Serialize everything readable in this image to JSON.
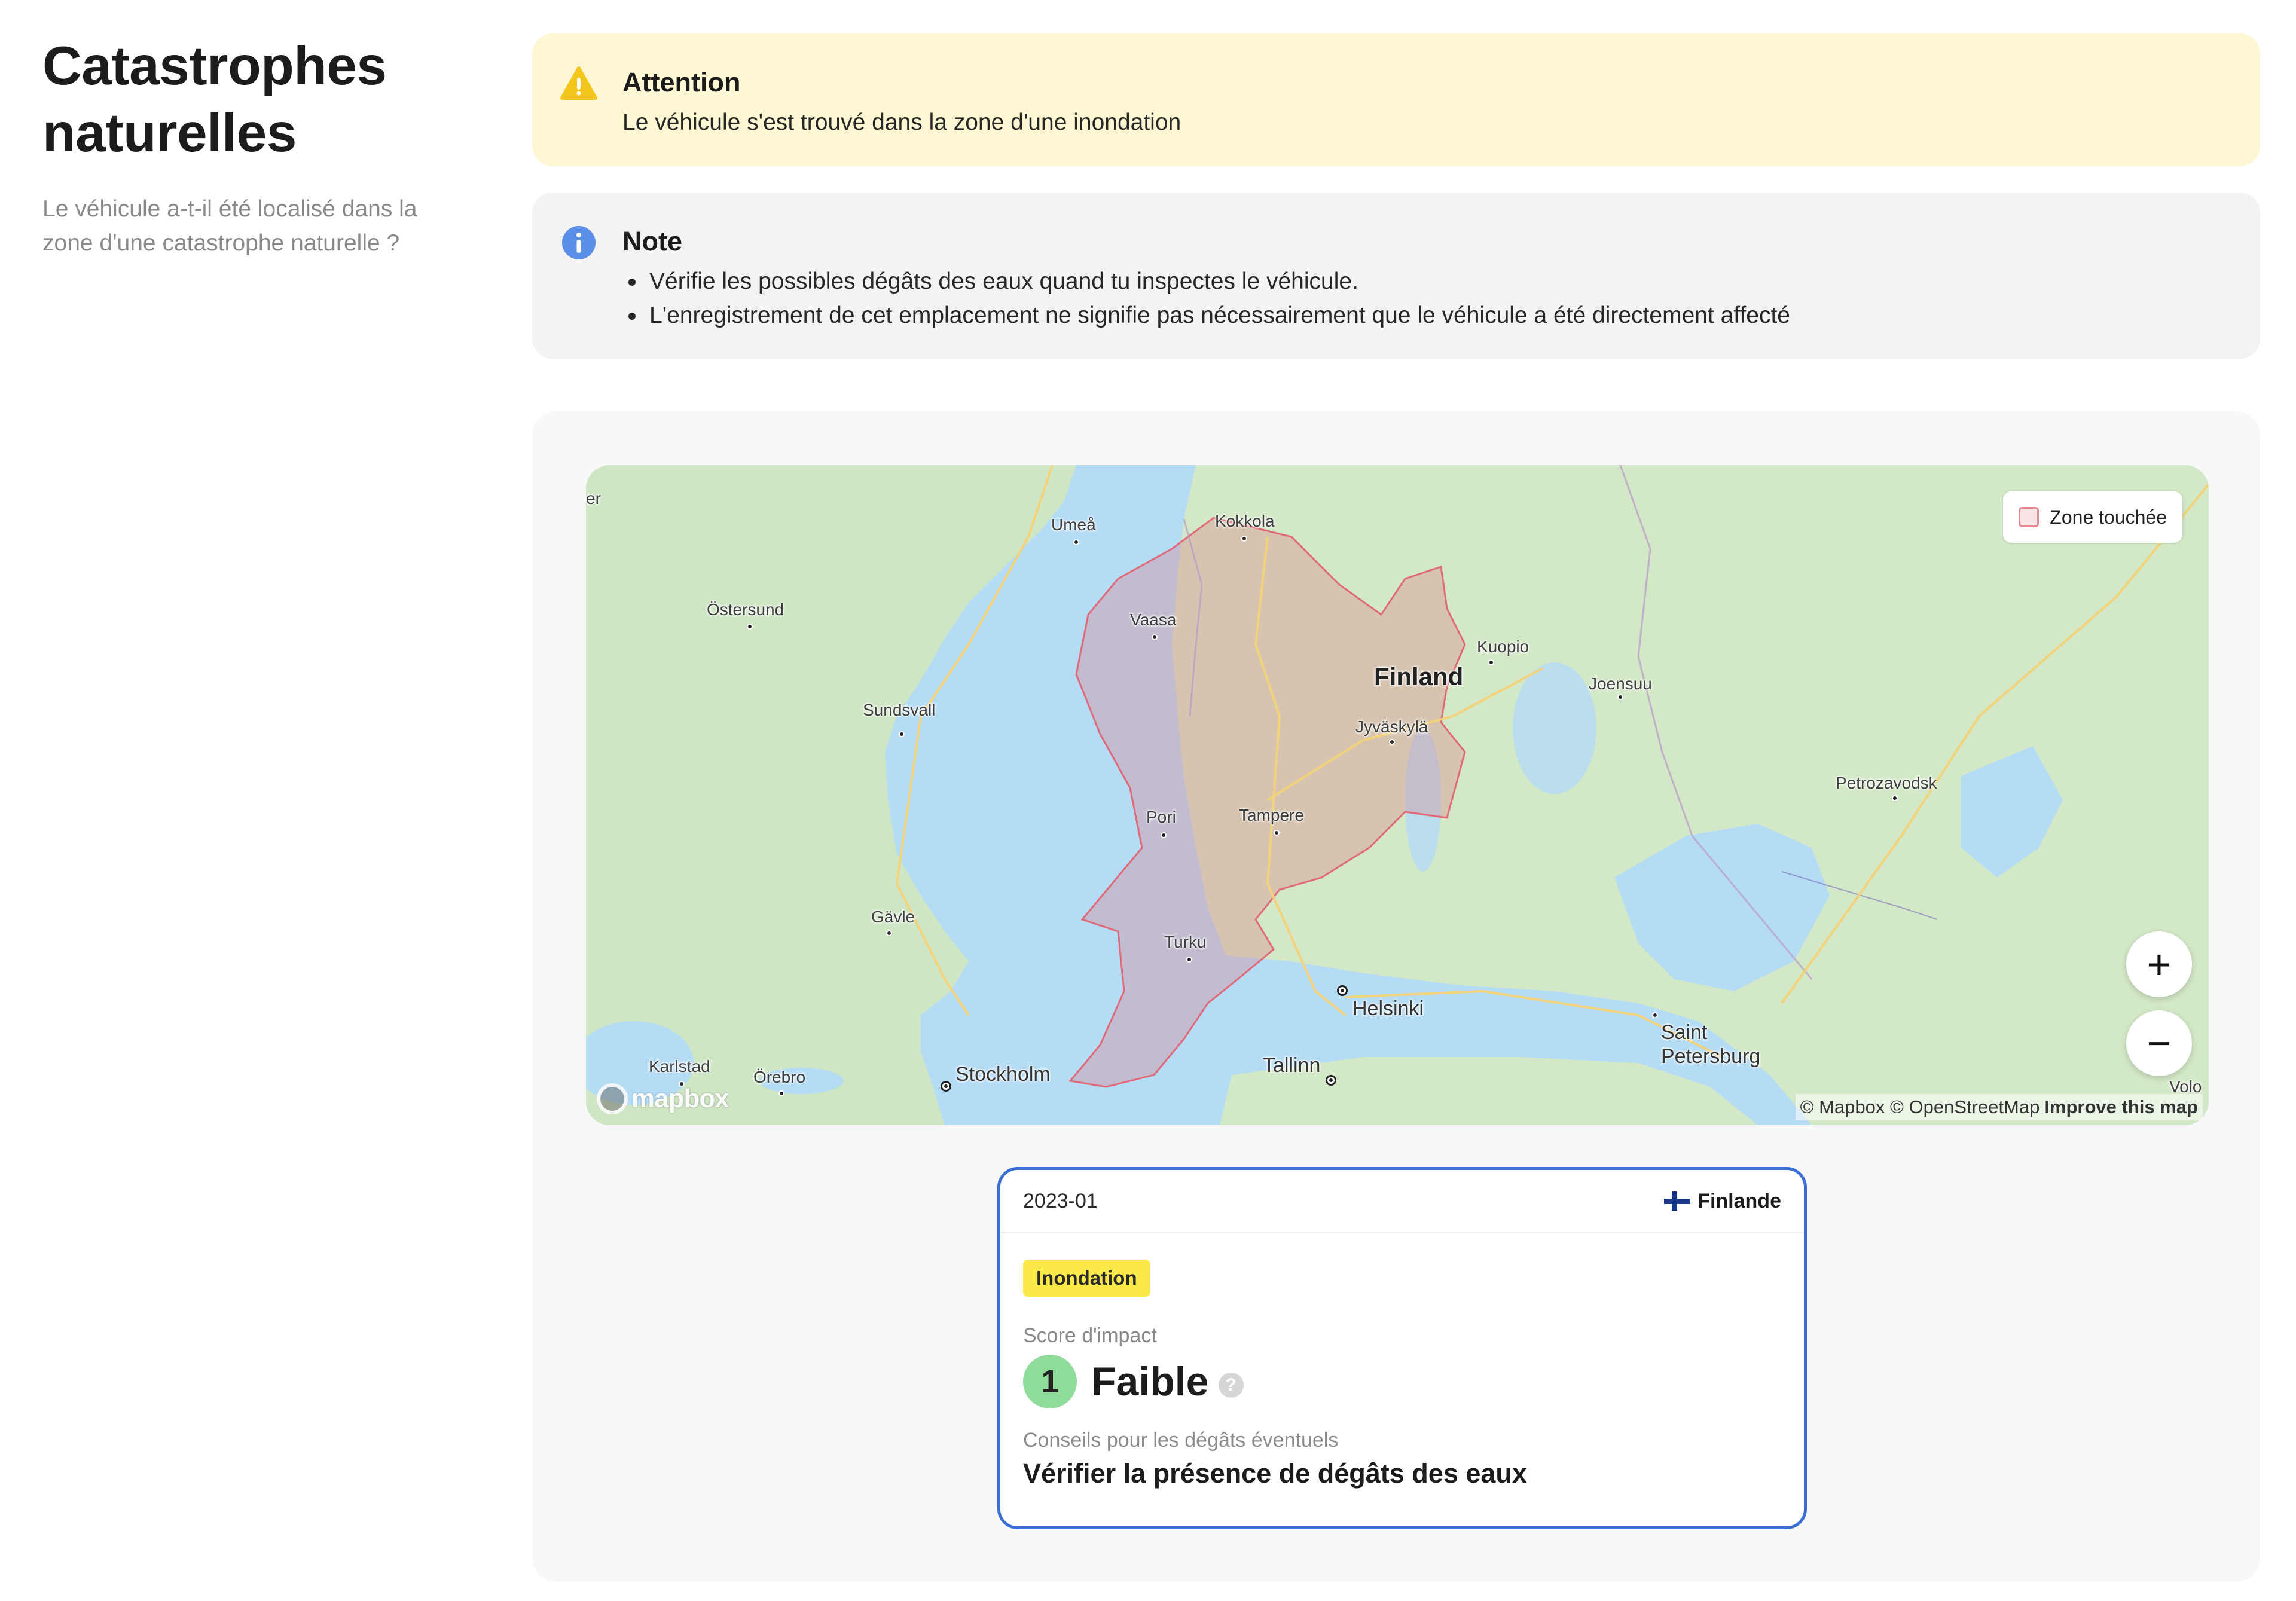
{
  "section": {
    "title_line1": "Catastrophes",
    "title_line2": "naturelles",
    "subtitle": "Le véhicule a-t-il été localisé dans la zone d'une catastrophe naturelle ?"
  },
  "warning": {
    "icon": "warning-icon",
    "title": "Attention",
    "text": "Le véhicule s'est trouvé dans la zone d'une inondation",
    "color": "#fdf8d3"
  },
  "note": {
    "icon": "info-icon",
    "title": "Note",
    "items": [
      "Vérifie les possibles dégâts des eaux quand tu inspectes le véhicule.",
      "L'enregistrement de cet emplacement ne signifie pas nécessairement que le véhicule a été directement affecté"
    ]
  },
  "map": {
    "legend_label": "Zone touchée",
    "zoom_in": "+",
    "zoom_out": "−",
    "logo_text": "mapbox",
    "attribution": "© Mapbox © OpenStreetMap",
    "improve_link": "Improve this map",
    "labels": {
      "finland": "Finland",
      "kokkola": "Kokkola",
      "umea": "Umeå",
      "vaasa": "Vaasa",
      "ostersund": "Östersund",
      "kuopio": "Kuopio",
      "joensuu": "Joensuu",
      "jyvaskyla": "Jyväskylä",
      "sundsvall": "Sundsvall",
      "pori": "Pori",
      "tampere": "Tampere",
      "petrozavodsk": "Petrozavodsk",
      "gavle": "Gävle",
      "turku": "Turku",
      "helsinki": "Helsinki",
      "saint": "Saint",
      "petersburg": "Petersburg",
      "tallinn": "Tallinn",
      "karlstad": "Karlstad",
      "orebro": "Örebro",
      "stockholm": "Stockholm",
      "volo": "Volo",
      "edge_left": "er"
    },
    "zone_color": "#e06a78"
  },
  "card": {
    "date": "2023-01",
    "country": "Finlande",
    "tag": "Inondation",
    "score_label": "Score d'impact",
    "score_value": "1",
    "score_text": "Faible",
    "help": "?",
    "advice_label": "Conseils pour les dégâts éventuels",
    "advice_text": "Vérifier la présence de dégâts des eaux",
    "border_color": "#3b6fd6"
  }
}
